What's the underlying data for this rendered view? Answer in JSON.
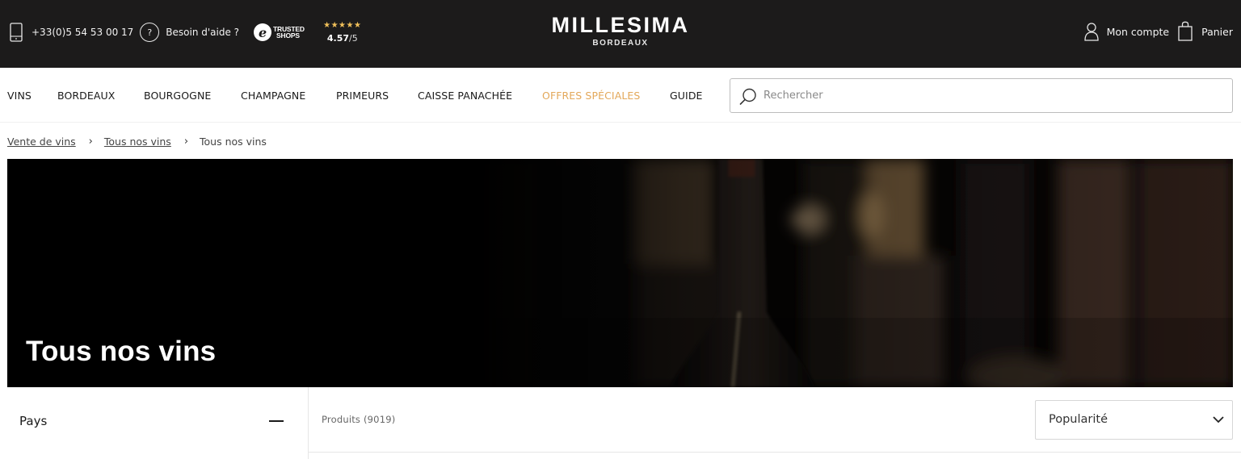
{
  "topbar": {
    "phone": "+33(0)5 54 53 00 17",
    "help_icon_glyph": "?",
    "help_label": "Besoin d'aide ?",
    "trusted_shops_lines": [
      "TRUSTED",
      "SHOPS"
    ],
    "rating_stars": "★★★★★",
    "rating_value": "4.57",
    "rating_scale": "/5",
    "logo_main": "MILLESIMA",
    "logo_sub": "BORDEAUX",
    "account_label": "Mon compte",
    "cart_label": "Panier"
  },
  "nav": {
    "items": [
      "VINS",
      "BORDEAUX",
      "BOURGOGNE",
      "CHAMPAGNE",
      "PRIMEURS",
      "CAISSE PANACHÉE",
      "OFFRES SPÉCIALES",
      "GUIDE"
    ],
    "search_placeholder": "Rechercher"
  },
  "breadcrumb": {
    "items": [
      "Vente de vins",
      "Tous nos vins",
      "Tous nos vins"
    ],
    "separator": "›"
  },
  "hero": {
    "title": "Tous nos vins"
  },
  "filters": {
    "label": "Pays",
    "expanded": true
  },
  "products": {
    "count_label": "Produits (9019)"
  },
  "sort": {
    "selected": "Popularité"
  },
  "colors": {
    "topbar_bg": "#1c1b1b",
    "special_offer": "#e3a85a",
    "star": "#f0c05a"
  },
  "icons": [
    "phone-icon",
    "help-icon",
    "trusted-shops-logo",
    "user-icon",
    "bag-icon",
    "search-icon",
    "chevron-down-icon",
    "minus-icon"
  ]
}
